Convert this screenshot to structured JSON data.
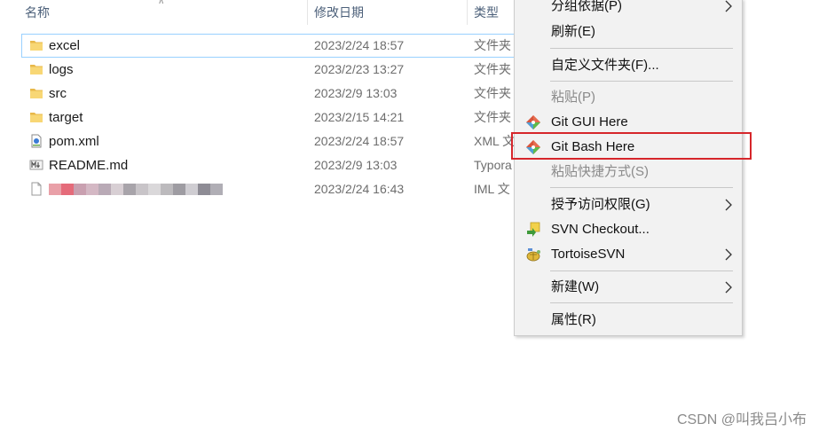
{
  "columns": {
    "name": "名称",
    "date_modified": "修改日期",
    "type": "类型"
  },
  "files": [
    {
      "name": "excel",
      "date": "2023/2/24 18:57",
      "type": "文件夹",
      "icon": "folder-icon"
    },
    {
      "name": "logs",
      "date": "2023/2/23 13:27",
      "type": "文件夹",
      "icon": "folder-icon"
    },
    {
      "name": "src",
      "date": "2023/2/9 13:03",
      "type": "文件夹",
      "icon": "folder-icon"
    },
    {
      "name": "target",
      "date": "2023/2/15 14:21",
      "type": "文件夹",
      "icon": "folder-icon"
    },
    {
      "name": "pom.xml",
      "date": "2023/2/24 18:57",
      "type": "XML 文",
      "icon": "xml-file-icon"
    },
    {
      "name": "README.md",
      "date": "2023/2/9 13:03",
      "type": "Typora",
      "icon": "markdown-file-icon"
    },
    {
      "name": "",
      "date": "2023/2/24 16:43",
      "type": "IML 文",
      "icon": "blank-file-icon"
    }
  ],
  "context_menu": {
    "items": [
      {
        "label": "分组依据(P)",
        "submenu": true,
        "disabled": false,
        "icon": ""
      },
      {
        "label": "刷新(E)",
        "submenu": false,
        "disabled": false,
        "icon": ""
      },
      {
        "label": "自定义文件夹(F)...",
        "submenu": false,
        "disabled": false,
        "icon": ""
      },
      {
        "label": "粘贴(P)",
        "submenu": false,
        "disabled": true,
        "icon": ""
      },
      {
        "label": "Git GUI Here",
        "submenu": false,
        "disabled": false,
        "icon": "git-icon"
      },
      {
        "label": "Git Bash Here",
        "submenu": false,
        "disabled": false,
        "icon": "git-icon"
      },
      {
        "label": "粘贴快捷方式(S)",
        "submenu": false,
        "disabled": true,
        "icon": ""
      },
      {
        "label": "授予访问权限(G)",
        "submenu": true,
        "disabled": false,
        "icon": ""
      },
      {
        "label": "SVN Checkout...",
        "submenu": false,
        "disabled": false,
        "icon": "svn-checkout-icon"
      },
      {
        "label": "TortoiseSVN",
        "submenu": true,
        "disabled": false,
        "icon": "tortoisesvn-icon"
      },
      {
        "label": "新建(W)",
        "submenu": true,
        "disabled": false,
        "icon": ""
      },
      {
        "label": "属性(R)",
        "submenu": false,
        "disabled": false,
        "icon": ""
      }
    ]
  },
  "watermark": "CSDN @叫我吕小布",
  "colors": {
    "highlight_border": "#d6262b",
    "menu_background": "#f2f2f2",
    "focus_border": "#99d1ff",
    "folder_yellow": "#f8d775"
  }
}
